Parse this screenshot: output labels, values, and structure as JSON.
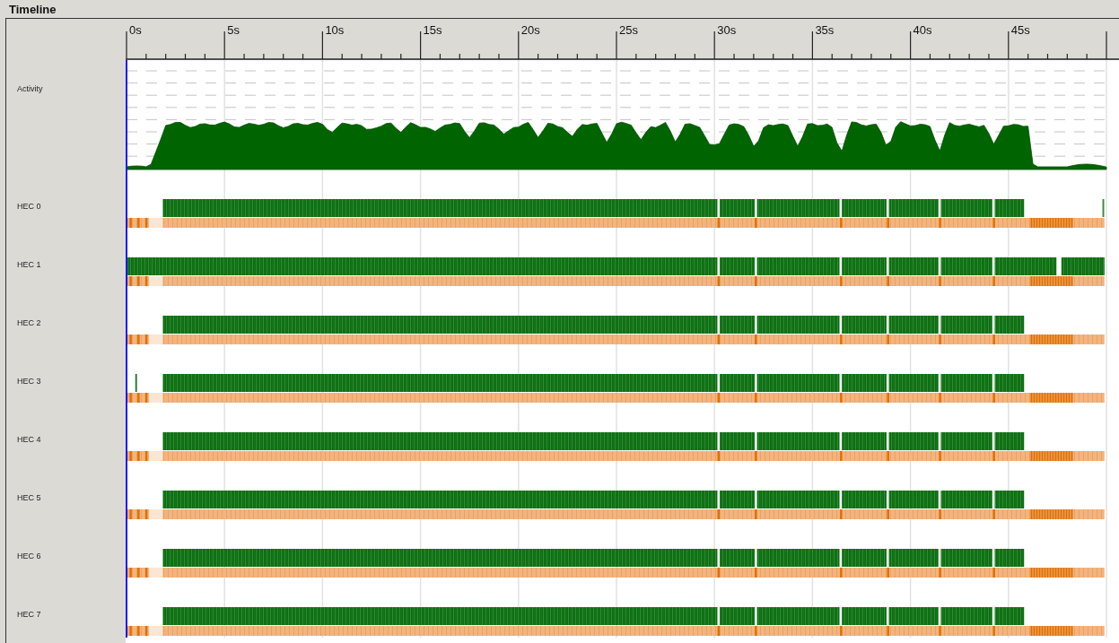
{
  "title": "Timeline",
  "axis": {
    "ticks": [
      "0s",
      "5s",
      "10s",
      "15s",
      "20s",
      "25s",
      "30s",
      "35s",
      "40s",
      "45s"
    ]
  },
  "tracks": [
    {
      "label": "Activity",
      "kind": "activity"
    },
    {
      "label": "HEC 0",
      "kind": "hec"
    },
    {
      "label": "HEC 1",
      "kind": "hec"
    },
    {
      "label": "HEC 2",
      "kind": "hec"
    },
    {
      "label": "HEC 3",
      "kind": "hec"
    },
    {
      "label": "HEC 4",
      "kind": "hec"
    },
    {
      "label": "HEC 5",
      "kind": "hec"
    },
    {
      "label": "HEC 6",
      "kind": "hec"
    },
    {
      "label": "HEC 7",
      "kind": "hec"
    }
  ]
}
